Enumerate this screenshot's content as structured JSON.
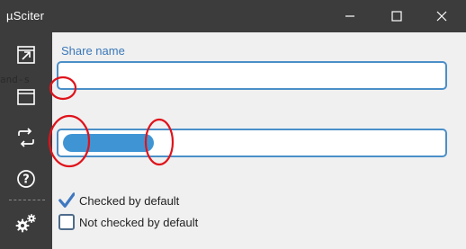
{
  "window": {
    "title": "µSciter",
    "controls": [
      "minimize-icon",
      "maximize-icon",
      "close-icon"
    ]
  },
  "sidebar": {
    "items": [
      {
        "icon": "open-window-icon"
      },
      {
        "icon": "window-icon"
      },
      {
        "icon": "refresh-icon"
      },
      {
        "icon": "help-icon"
      },
      {
        "icon": "settings-icon"
      }
    ]
  },
  "form": {
    "share_name_label": "Share name",
    "share_name_value": "",
    "progress_fraction": 0.24,
    "leaked_text": "and-s",
    "checkbox_checked_label": "Checked by default",
    "checkbox_checked": true,
    "checkbox_unchecked_label": "Not checked by default",
    "checkbox_unchecked": false
  },
  "colors": {
    "titlebar": "#3c3c3c",
    "sidebar": "#3c3c3c",
    "content_bg": "#f0f0f0",
    "accent": "#3f95d4",
    "label": "#3a78b8",
    "annotation": "#e0131b"
  }
}
